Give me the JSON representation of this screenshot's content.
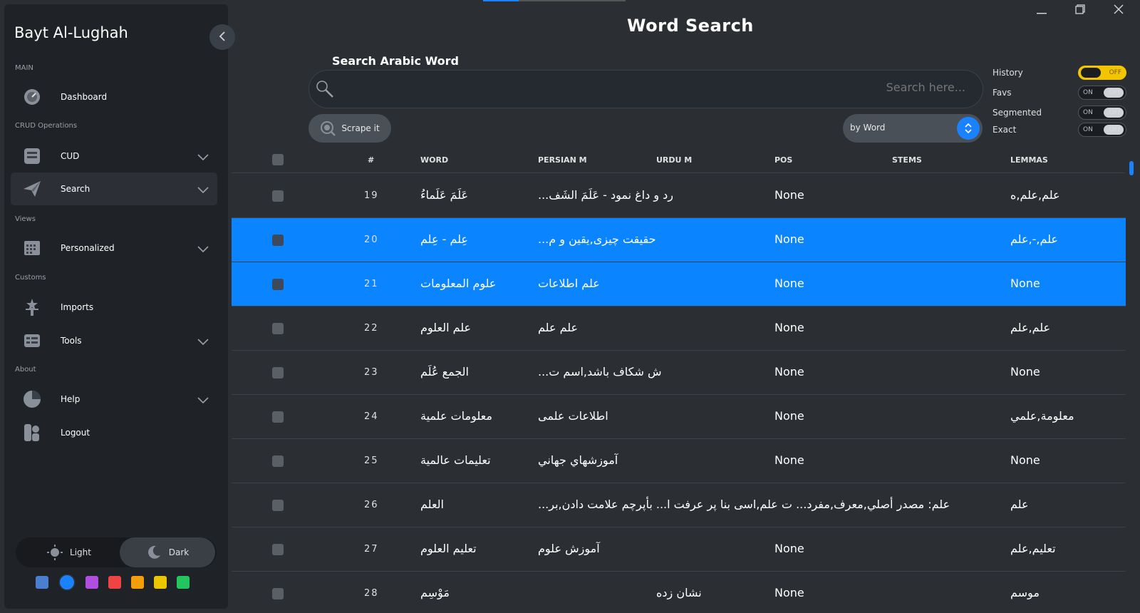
{
  "app": {
    "title": "Bayt Al-Lughah"
  },
  "sidebar": {
    "sections": [
      {
        "label": "MAIN"
      },
      {
        "label": "CRUD Operations"
      },
      {
        "label": "Views"
      },
      {
        "label": "Customs"
      },
      {
        "label": "About"
      }
    ],
    "items": [
      {
        "label": "Dashboard",
        "icon": "gauge-icon"
      },
      {
        "label": "CUD",
        "icon": "database-icon"
      },
      {
        "label": "Search",
        "icon": "paper-plane-icon"
      },
      {
        "label": "Personalized",
        "icon": "calendar-grid-icon"
      },
      {
        "label": "Imports",
        "icon": "person-star-icon"
      },
      {
        "label": "Tools",
        "icon": "tools-list-icon"
      },
      {
        "label": "Help",
        "icon": "pie-chart-icon"
      },
      {
        "label": "Logout",
        "icon": "logout-icon"
      }
    ],
    "theme": {
      "light_label": "Light",
      "dark_label": "Dark",
      "selected": "Dark"
    },
    "swatches": [
      "#4a7fd0",
      "#1a82ff",
      "#b04ee0",
      "#ef4444",
      "#f59e0b",
      "#eac500",
      "#22c55e"
    ]
  },
  "main": {
    "title": "Word Search",
    "search_label": "Search Arabic Word",
    "search_placeholder": "Search here...",
    "scrape_label": "Scrape it",
    "search_mode": "by Word",
    "toggles": [
      {
        "label": "History",
        "on": true
      },
      {
        "label": "Favs",
        "on": false
      },
      {
        "label": "Segmented",
        "on": false
      },
      {
        "label": "Exact",
        "on": false
      }
    ],
    "toggle_on_text": "ON",
    "toggle_off_text": "OFF"
  },
  "table": {
    "headers": [
      "#",
      "WORD",
      "PERSIAN M",
      "URDU M",
      "POS",
      "STEMS",
      "LEMMAS"
    ],
    "rows": [
      {
        "num": "19",
        "word": "عَلَمَ عَلَماءُ",
        "persian": "...رد و داغ نمود - عَلَمَ الشَف",
        "urdu": "",
        "pos": "None",
        "stems": "",
        "lemmas": "علم,علم,ه",
        "selected": false
      },
      {
        "num": "20",
        "word": "عِلم - عِلم",
        "persian": "...حقیقت چیزی,یقین و م",
        "urdu": "",
        "pos": "None",
        "stems": "",
        "lemmas": "علم,-,علم",
        "selected": true
      },
      {
        "num": "21",
        "word": "علوم المعلومات",
        "persian": "علم اطلاعات",
        "urdu": "",
        "pos": "None",
        "stems": "",
        "lemmas": "None",
        "selected": true
      },
      {
        "num": "22",
        "word": "علم العلوم",
        "persian": "علم علم",
        "urdu": "",
        "pos": "None",
        "stems": "",
        "lemmas": "علم,علم",
        "selected": false
      },
      {
        "num": "23",
        "word": "الجمع عُلَم",
        "persian": "...ش شکاف باشد,اسم ت",
        "urdu": "",
        "pos": "None",
        "stems": "",
        "lemmas": "None",
        "selected": false
      },
      {
        "num": "24",
        "word": "معلومات علمية",
        "persian": "اطلاعات علمی",
        "urdu": "",
        "pos": "None",
        "stems": "",
        "lemmas": "معلومة,علمي",
        "selected": false
      },
      {
        "num": "25",
        "word": "تعليمات عالمية",
        "persian": "آموزشهاي جهاني",
        "urdu": "",
        "pos": "None",
        "stems": "",
        "lemmas": "None",
        "selected": false
      },
      {
        "num": "26",
        "word": "العلم",
        "persian": "...علم: مصدر أصلي,معرف,مفرد... ت علم,اسی بنا پر عرفت ا... بأپرچم علامت دادن,بر",
        "urdu": "",
        "pos": "",
        "stems": "",
        "lemmas": "علم",
        "selected": false
      },
      {
        "num": "27",
        "word": "تعليم العلوم",
        "persian": "آموزش علوم",
        "urdu": "",
        "pos": "None",
        "stems": "",
        "lemmas": "تعليم,علم",
        "selected": false
      },
      {
        "num": "28",
        "word": "مَوْسِم",
        "persian": "",
        "urdu": "نشان زده",
        "pos": "None",
        "stems": "",
        "lemmas": "موسم",
        "selected": false
      }
    ]
  },
  "colors": {
    "accent": "#1a82ff",
    "toggle_on": "#f3c400",
    "row_selected": "#0a84ff",
    "sidebar_bg": "#1f2226",
    "main_bg": "#2b2f34"
  }
}
